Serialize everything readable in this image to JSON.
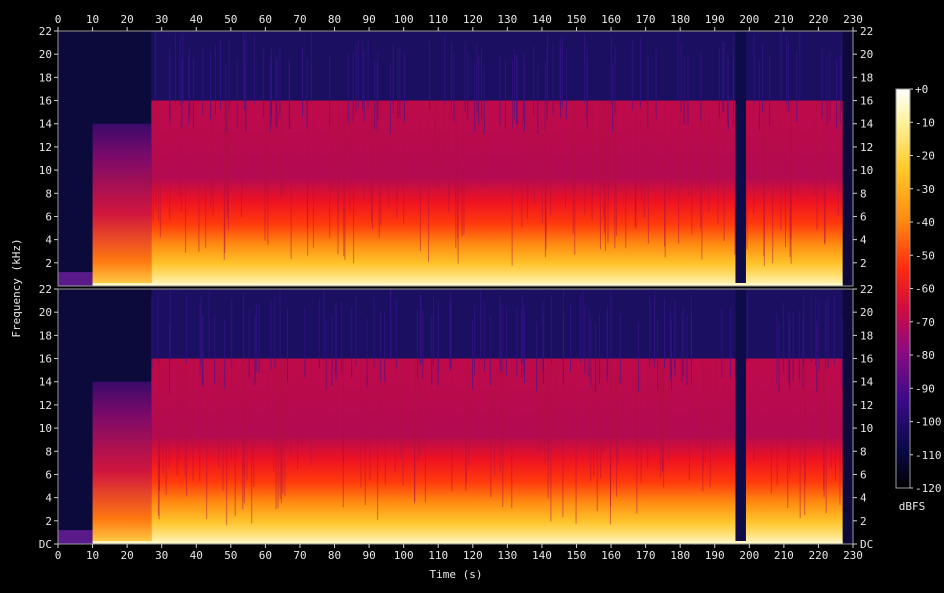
{
  "chart_data": {
    "type": "heatmap",
    "subtype": "stereo spectrogram",
    "channels": 2,
    "xlabel": "Time (s)",
    "ylabel": "Frequency (kHz)",
    "colorbar_label": "dBFS",
    "xlim": [
      0,
      230
    ],
    "x_ticks": [
      "0",
      "10",
      "20",
      "30",
      "40",
      "50",
      "60",
      "70",
      "80",
      "90",
      "100",
      "110",
      "120",
      "130",
      "140",
      "150",
      "160",
      "170",
      "180",
      "190",
      "200",
      "210",
      "220",
      "230"
    ],
    "ylim_khz": [
      0,
      22
    ],
    "y_ticks_top": [
      "2",
      "4",
      "6",
      "8",
      "10",
      "12",
      "14",
      "16",
      "18",
      "20",
      "22"
    ],
    "y_ticks_bottom": [
      "DC",
      "2",
      "4",
      "6",
      "8",
      "10",
      "12",
      "14",
      "16",
      "18",
      "20",
      "22"
    ],
    "colorbar_range_db": [
      -120,
      0
    ],
    "colorbar_ticks": [
      "+0",
      "-10",
      "-20",
      "-30",
      "-40",
      "-50",
      "-60",
      "-70",
      "-80",
      "-90",
      "-100",
      "-110",
      "-120"
    ],
    "features": {
      "quiet_intro_end_s": 10,
      "buildup_end_s": 27,
      "lowpass_cutoff_khz": 16,
      "dropout_start_s": 196,
      "dropout_end_s": 199,
      "music_end_s": 227
    }
  }
}
